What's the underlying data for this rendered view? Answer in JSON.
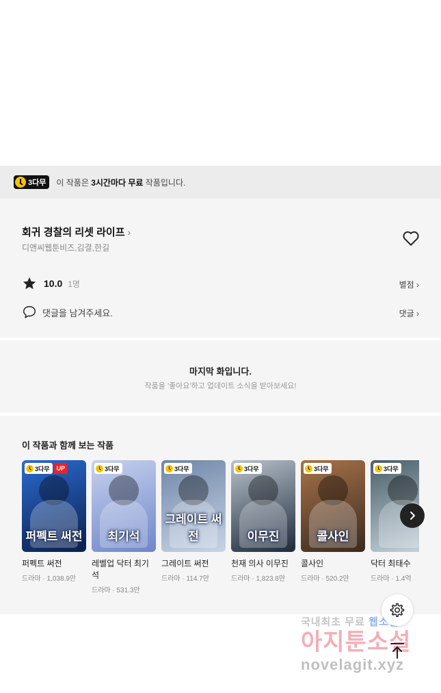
{
  "free_banner": {
    "badge": "3다무",
    "text_prefix": "이 작품은 ",
    "text_bold": "3시간마다 무료",
    "text_suffix": " 작품입니다."
  },
  "work": {
    "title": "회귀 경찰의 리셋 라이프",
    "authors": "디앤씨웹툰비즈,김결,한길",
    "rating": "10.0",
    "rating_count": "1명",
    "rate_link": "별점",
    "comment_placeholder": "댓글을 남겨주세요.",
    "comment_link": "댓글"
  },
  "last_episode": {
    "title": "마지막 화입니다.",
    "subtitle": "작품을 '좋아요'하고 업데이트 소식을 받아보세요!"
  },
  "recommended": {
    "title": "이 작품과 함께 보는 작품",
    "items": [
      {
        "name": "퍼펙트 써전",
        "meta": "드라마 · 1,038.9만",
        "badge": "3다무",
        "up": "UP",
        "cover_text": "퍼펙트 써전",
        "colors": [
          "#0b1f4a",
          "#2a6bd1"
        ]
      },
      {
        "name": "레벨업 닥터 최기석",
        "meta": "드라마 · 531.3만",
        "badge": "3다무",
        "cover_text": "최기석",
        "colors": [
          "#6f86c9",
          "#c7d2ee"
        ]
      },
      {
        "name": "그레이트 써전",
        "meta": "드라마 · 114.7만",
        "badge": "3다무",
        "cover_text": "그레이트 써전",
        "colors": [
          "#c9d4e6",
          "#6f87a8"
        ]
      },
      {
        "name": "천재 의사 이무진",
        "meta": "드라마 · 1,823.8만",
        "badge": "3다무",
        "cover_text": "이무진",
        "colors": [
          "#1d2a3b",
          "#b9c2cc"
        ]
      },
      {
        "name": "콜사인",
        "meta": "드라마 · 520.2만",
        "badge": "3다무",
        "cover_text": "콜사인",
        "colors": [
          "#3a2a1e",
          "#a8734a"
        ]
      },
      {
        "name": "닥터 최태수",
        "meta": "드라마 · 1.4억",
        "badge": "3다무",
        "cover_text": "",
        "colors": [
          "#c8d6de",
          "#4a5f6a"
        ]
      }
    ]
  },
  "watermark": {
    "line1_gray": "국내최초 무료 ",
    "line1_blue": "웹소설",
    "line2": "아지툰소설",
    "line3": "novelagit.xyz"
  },
  "icons": {
    "heart": "heart-outline-icon",
    "star": "star-filled-icon",
    "comment": "speech-bubble-icon",
    "next": "chevron-right-icon",
    "settings": "gear-icon",
    "top": "arrow-up-icon"
  }
}
